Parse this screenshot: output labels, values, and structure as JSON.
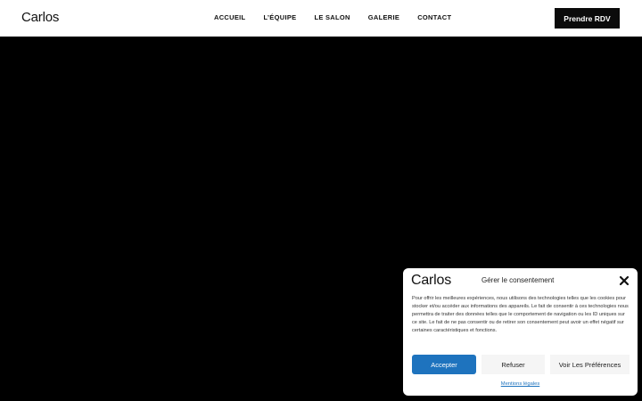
{
  "header": {
    "logo": "Carlos",
    "nav": [
      {
        "label": "ACCUEIL"
      },
      {
        "label": "L’ÉQUIPE"
      },
      {
        "label": "LE SALON"
      },
      {
        "label": "GALERIE"
      },
      {
        "label": "CONTACT"
      }
    ],
    "cta_label": "Prendre RDV"
  },
  "consent": {
    "logo": "Carlos",
    "title": "Gérer le consentement",
    "close_icon": "close-icon",
    "text": "Pour offrir les meilleures expériences, nous utilisons des technologies telles que les cookies pour stocker et/ou accéder aux informations des appareils. Le fait de consentir à ces technologies nous permettra de traiter des données telles que le comportement de navigation ou les ID uniques sur ce site. Le fait de ne pas consentir ou de retirer son consentement peut avoir un effet négatif sur certaines caractéristiques et fonctions.",
    "accept_label": "Accepter",
    "refuse_label": "Refuser",
    "prefs_label": "Voir Les Préférences",
    "legal_label": "Mentions légales"
  },
  "colors": {
    "accent": "#1e73be",
    "header_bg": "#ffffff",
    "hero_bg": "#000000",
    "cta_bg": "#0b0b0b"
  }
}
